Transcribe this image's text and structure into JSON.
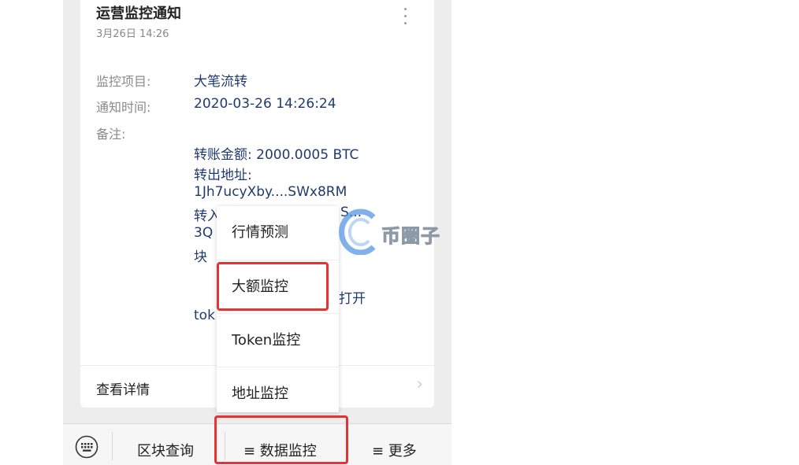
{
  "notification": {
    "title": "运营监控通知",
    "time": "3月26日 14:26",
    "fields": {
      "project_label": "监控项目:",
      "project_value": "大笔流转",
      "notify_label": "通知时间:",
      "notify_value": "2020-03-26 14:26:24",
      "remark_label": "备注:"
    },
    "remark_lines": [
      "转账金额: 2000.0005 BTC",
      "转出地址:",
      "1Jh7ucyXby....SWx8RM",
      "转入",
      "3Q",
      "块",
      "打开",
      "tok"
    ],
    "remark_partial_right": "S...",
    "detail_label": "查看详情",
    "detail_arrow": "›"
  },
  "popup_menu": {
    "items": [
      "行情预测",
      "大额监控",
      "Token监控",
      "地址监控"
    ],
    "highlighted": "大额监控"
  },
  "bottom_bar": {
    "keyboard_icon": "keyboard-icon",
    "items": [
      "区块查询",
      "≡ 数据监控",
      "≡ 更多"
    ],
    "highlighted": "≡ 数据监控"
  },
  "watermark": {
    "text": "币圈子"
  },
  "colors": {
    "highlight_border": "#e53333",
    "value_text": "#1f3a6e",
    "label_text": "#8a8a8a",
    "watermark_blue": "#4a90e2"
  }
}
